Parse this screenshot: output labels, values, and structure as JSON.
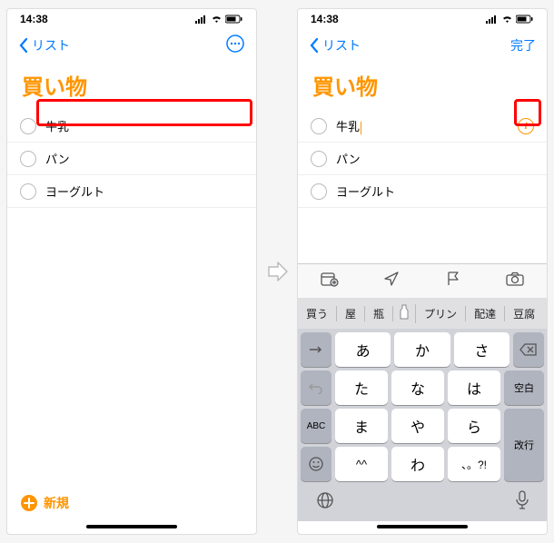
{
  "status": {
    "time": "14:38"
  },
  "nav": {
    "back": "リスト",
    "done": "完了"
  },
  "list": {
    "title": "買い物"
  },
  "items": [
    "牛乳",
    "パン",
    "ヨーグルト"
  ],
  "add_new": "新規",
  "suggestions": [
    "買う",
    "屋",
    "瓶",
    "プリン",
    "配達",
    "豆腐"
  ],
  "keys": {
    "row1": [
      "あ",
      "か",
      "さ"
    ],
    "row2": [
      "た",
      "な",
      "は"
    ],
    "row3": [
      "ま",
      "や",
      "ら"
    ],
    "row4": [
      "^^",
      "わ",
      "、。?!"
    ],
    "space": "空白",
    "return": "改行",
    "abc": "ABC"
  }
}
